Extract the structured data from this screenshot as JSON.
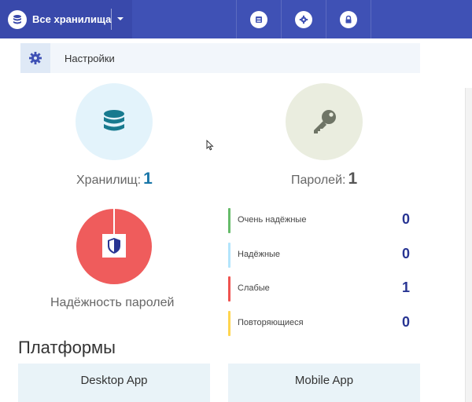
{
  "header": {
    "vault_selector_label": "Все хранилища",
    "tabs": [
      {
        "name": "list",
        "icon": "list-icon"
      },
      {
        "name": "settings",
        "icon": "gear-icon"
      },
      {
        "name": "lock",
        "icon": "lock-icon"
      }
    ]
  },
  "settings": {
    "label": "Настройки",
    "icon": "gear-icon"
  },
  "stats": {
    "vaults_label": "Хранилищ:",
    "vaults_count": "1",
    "passwords_label": "Паролей:",
    "passwords_count": "1"
  },
  "strength": {
    "caption": "Надёжность паролей",
    "categories": [
      {
        "label": "Очень надёжные",
        "value": "0",
        "color": "#66bb6a"
      },
      {
        "label": "Надёжные",
        "value": "0",
        "color": "#b3e5fc"
      },
      {
        "label": "Слабые",
        "value": "1",
        "color": "#ef5350"
      },
      {
        "label": "Повторяющиеся",
        "value": "0",
        "color": "#ffd54f"
      }
    ]
  },
  "platforms": {
    "title": "Платформы",
    "items": [
      "Desktop App",
      "Mobile App"
    ]
  },
  "colors": {
    "header_bg": "#3f51b5",
    "vault_circle_bg": "#e3f3fb",
    "password_circle_bg": "#eaeddf",
    "weak_red": "#ef5c5c",
    "accent_number": "#1976a8"
  }
}
